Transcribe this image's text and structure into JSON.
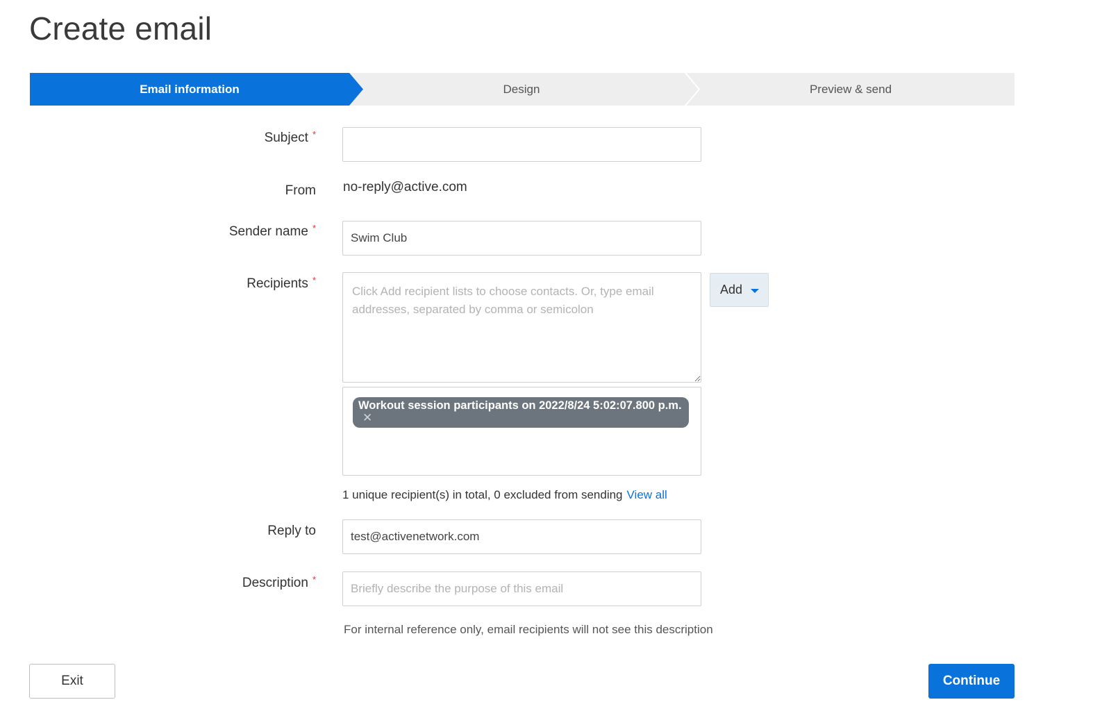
{
  "page": {
    "title": "Create email"
  },
  "stepper": {
    "steps": [
      {
        "label": "Email information",
        "active": true
      },
      {
        "label": "Design",
        "active": false
      },
      {
        "label": "Preview & send",
        "active": false
      }
    ]
  },
  "form": {
    "required_mark": "*",
    "subject": {
      "label": "Subject",
      "value": "",
      "required": true
    },
    "from": {
      "label": "From",
      "value": "no-reply@active.com"
    },
    "sender_name": {
      "label": "Sender name",
      "value": "Swim Club",
      "required": true
    },
    "recipients": {
      "label": "Recipients",
      "required": true,
      "placeholder": "Click Add recipient lists to choose contacts. Or, type email addresses, separated by comma or semicolon",
      "value": "",
      "add_button": "Add",
      "lists": [
        {
          "name": "Workout session participants on 2022/8/24 5:02:07.800 p.m.",
          "remove_icon": "close-icon"
        }
      ],
      "summary_text": "1 unique recipient(s) in total, 0 excluded from sending",
      "view_all": "View all"
    },
    "reply_to": {
      "label": "Reply to",
      "value": "test@activenetwork.com"
    },
    "description": {
      "label": "Description",
      "required": true,
      "placeholder": "Briefly describe the purpose of this email",
      "value": "",
      "helper": "For internal reference only, email recipients will not see this description"
    }
  },
  "footer": {
    "exit_label": "Exit",
    "continue_label": "Continue"
  },
  "colors": {
    "primary": "#0a73db",
    "required": "#e0342f",
    "tag_bg": "#6c757d",
    "stepper_bg": "#eeeeee"
  }
}
